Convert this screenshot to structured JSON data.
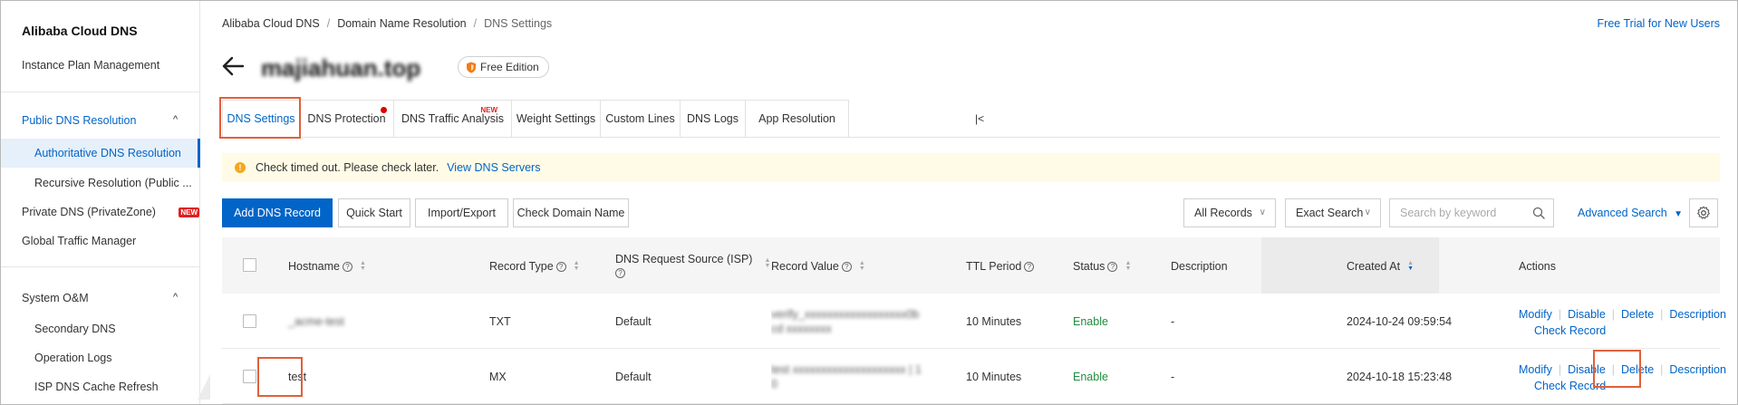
{
  "sidebar": {
    "title": "Alibaba Cloud DNS",
    "instance_plan": "Instance Plan Management",
    "public_dns": "Public DNS Resolution",
    "authoritative": "Authoritative DNS Resolution",
    "recursive": "Recursive Resolution (Public ...",
    "private_dns": "Private DNS (PrivateZone)",
    "private_new": "NEW",
    "gtm": "Global Traffic Manager",
    "system_om": "System O&M",
    "secondary": "Secondary DNS",
    "operation_logs": "Operation Logs",
    "isp_cache": "ISP DNS Cache Refresh"
  },
  "breadcrumb": {
    "items": [
      "Alibaba Cloud DNS",
      "Domain Name Resolution",
      "DNS Settings"
    ],
    "separator": "/"
  },
  "header": {
    "free_trial": "Free Trial for New Users",
    "domain": "majiahuan.top",
    "edition": "Free Edition"
  },
  "tabs": [
    {
      "label": "DNS Settings"
    },
    {
      "label": "DNS Protection"
    },
    {
      "label": "DNS Traffic Analysis",
      "badge": "NEW"
    },
    {
      "label": "Weight Settings"
    },
    {
      "label": "Custom Lines"
    },
    {
      "label": "DNS Logs"
    },
    {
      "label": "App Resolution"
    }
  ],
  "tab_collapse": "|<",
  "alert": {
    "message": "Check timed out. Please check later.",
    "link": "View DNS Servers"
  },
  "toolbar": {
    "add_record": "Add DNS Record",
    "quick_start": "Quick Start",
    "import_export": "Import/Export",
    "check_domain": "Check Domain Name",
    "all_records": "All Records",
    "exact_search": "Exact Search",
    "search_placeholder": "Search by keyword",
    "advanced_search": "Advanced Search"
  },
  "table": {
    "headers": {
      "hostname": "Hostname",
      "record_type": "Record Type",
      "request_source": "DNS Request Source (ISP)",
      "record_value": "Record Value",
      "ttl": "TTL Period",
      "status": "Status",
      "description": "Description",
      "created_at": "Created At",
      "actions": "Actions"
    },
    "rows": [
      {
        "hostname": "_acme-test",
        "record_type": "TXT",
        "source": "Default",
        "value_line1": "verify_xxxxxxxxxxxxxxxxxx0b",
        "value_line2": "cd xxxxxxxx",
        "ttl": "10 Minutes",
        "status": "Enable",
        "description": "-",
        "created_at": "2024-10-24 09:59:54"
      },
      {
        "hostname": "test",
        "record_type": "MX",
        "source": "Default",
        "value_line1": "test xxxxxxxxxxxxxxxxxxxx | 1",
        "value_line2": "0",
        "ttl": "10 Minutes",
        "status": "Enable",
        "description": "-",
        "created_at": "2024-10-18 15:23:48"
      }
    ],
    "actions": {
      "modify": "Modify",
      "disable": "Disable",
      "delete": "Delete",
      "description": "Description",
      "check_record": "Check Record"
    }
  },
  "colors": {
    "accent": "#0064c8",
    "highlight": "#e0603a",
    "enable": "#1e8e3e",
    "alert_bg": "#fffbe6"
  }
}
